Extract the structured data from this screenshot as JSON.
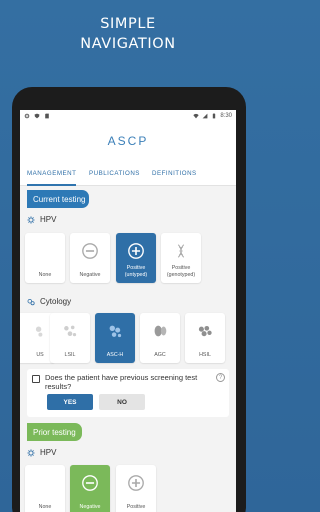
{
  "headline": {
    "line1": "SIMPLE",
    "line2": "NAVIGATION"
  },
  "status_bar": {
    "time": "8:30"
  },
  "app": {
    "logo": "ASCP"
  },
  "tabs": [
    {
      "label": "MANAGEMENT",
      "active": true
    },
    {
      "label": "PUBLICATIONS",
      "active": false
    },
    {
      "label": "DEFINITIONS",
      "active": false
    }
  ],
  "current_testing": {
    "label": "Current testing",
    "hpv": {
      "heading": "HPV",
      "options": [
        {
          "label": "None",
          "selected": false
        },
        {
          "label": "Negative",
          "selected": false
        },
        {
          "label": "Positive (untyped)",
          "selected": true
        },
        {
          "label": "Positive (genotyped)",
          "selected": false
        }
      ]
    },
    "cytology": {
      "heading": "Cytology",
      "options": [
        {
          "label": "US",
          "selected": false
        },
        {
          "label": "LSIL",
          "selected": false
        },
        {
          "label": "ASC-H",
          "selected": true
        },
        {
          "label": "AGC",
          "selected": false
        },
        {
          "label": "HSIL",
          "selected": false
        }
      ]
    },
    "question": {
      "text": "Does the patient have previous screening test results?",
      "help_icon": "?",
      "yes": "YES",
      "no": "NO"
    }
  },
  "prior_testing": {
    "label": "Prior testing",
    "hpv": {
      "heading": "HPV",
      "options": [
        {
          "label": "None",
          "selected": false
        },
        {
          "label": "Negative",
          "selected": true
        },
        {
          "label": "Positive",
          "selected": false
        }
      ]
    }
  },
  "colors": {
    "background": "#336ca0",
    "accent_blue": "#2f6fa7",
    "current_label": "#2d79b6",
    "prior_label": "#7bb95a",
    "selected_green": "#7bb95a"
  }
}
